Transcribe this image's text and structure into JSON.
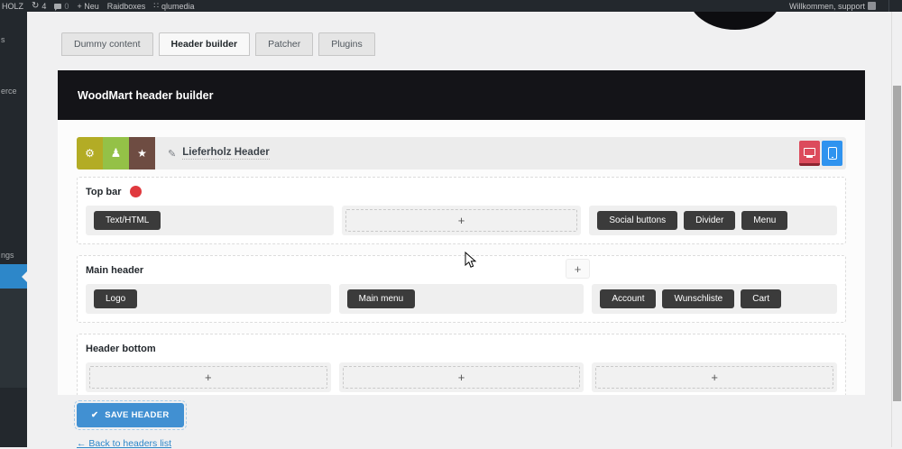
{
  "admin_bar": {
    "site_fragment": "HOLZ",
    "updates_count": "4",
    "comments_count": "0",
    "new_label": "+ Neu",
    "raidboxes_label": "Raidboxes",
    "user_label": "qlumedia",
    "welcome": "Willkommen, support"
  },
  "sidebar": {
    "fragments": [
      "s",
      "erce",
      "ngs"
    ]
  },
  "tabs": [
    {
      "label": "Dummy content",
      "active": false
    },
    {
      "label": "Header builder",
      "active": true
    },
    {
      "label": "Patcher",
      "active": false
    },
    {
      "label": "Plugins",
      "active": false
    }
  ],
  "panel": {
    "title": "WoodMart header builder",
    "save_label": "SAVE HEADER",
    "back_link": "← Back to headers list"
  },
  "toolbar": {
    "header_name": "Lieferholz Header"
  },
  "builder": {
    "sections": [
      {
        "title": "Top bar",
        "cells": [
          {
            "elements": [
              "Text/HTML"
            ]
          },
          {
            "empty": true
          },
          {
            "elements": [
              "Social buttons",
              "Divider",
              "Menu"
            ]
          }
        ]
      },
      {
        "title": "Main header",
        "cells": [
          {
            "elements": [
              "Logo"
            ]
          },
          {
            "elements": [
              "Main menu"
            ]
          },
          {
            "elements": [
              "Account",
              "Wunschliste",
              "Cart"
            ]
          }
        ]
      },
      {
        "title": "Header bottom",
        "cells": [
          {
            "empty": true
          },
          {
            "empty": true
          },
          {
            "empty": true
          }
        ]
      }
    ]
  },
  "icons": {
    "gear": "⚙",
    "person": "♟",
    "star": "★",
    "pencil": "✎",
    "check": "✔",
    "update": "↻",
    "plus": "+",
    "dots": "∷"
  },
  "colors": {
    "active_menu_blue": "#2d87c9",
    "save_button_blue": "#4190d2",
    "toolbar_yellow": "#b3ac25",
    "toolbar_green": "#94c147",
    "toolbar_brown": "#6e4c42",
    "desktop_toggle_red": "#dc4b5c",
    "mobile_toggle_blue": "#2f93ef",
    "red_dot": "#e0393e",
    "admin_bar_bg": "#23282d",
    "panel_header_bg": "#141418"
  }
}
